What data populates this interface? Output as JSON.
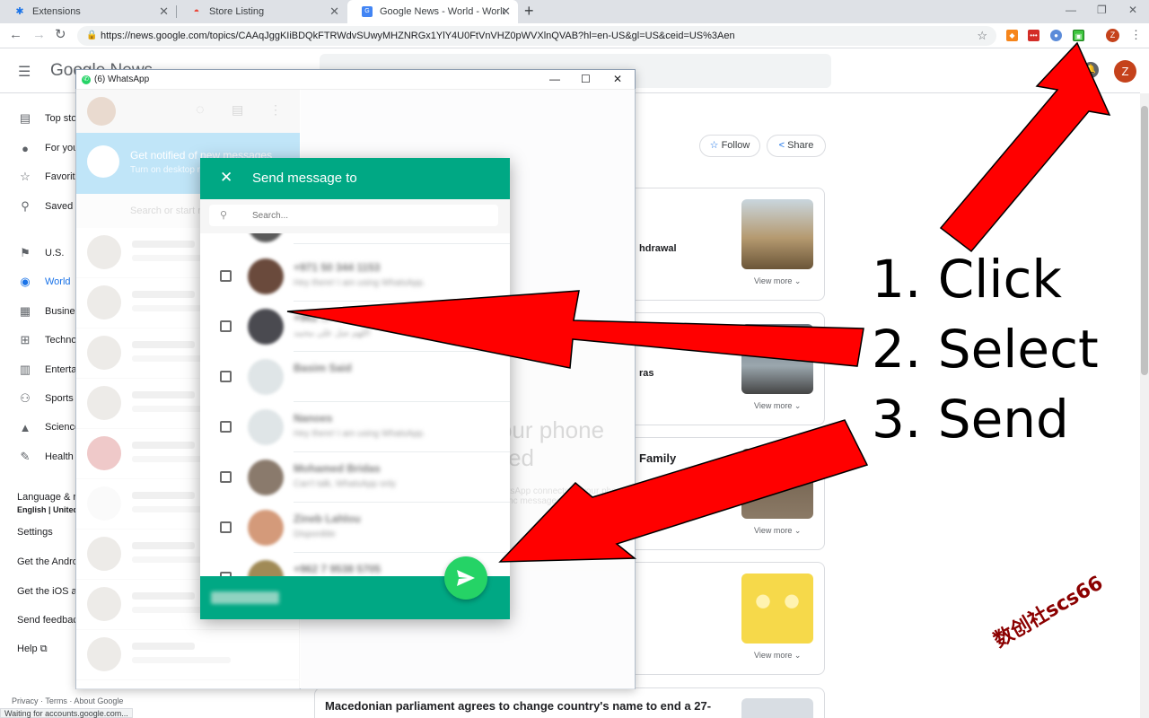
{
  "browser": {
    "tabs": [
      {
        "title": "Extensions",
        "icon": "puzzle-icon"
      },
      {
        "title": "Store Listing",
        "icon": "webstore-icon"
      },
      {
        "title": "Google News - World - World U",
        "icon": "google-news-icon"
      }
    ],
    "url": "https://news.google.com/topics/CAAqJggKIiBDQkFTRWdvSUwyMHZNRGx1YlY4U0FtVnVHZ0pWVXlnQVAB?hl=en-US&gl=US&ceid=US%3Aen",
    "profile_initial": "Z",
    "status": "Waiting for accounts.google.com..."
  },
  "news": {
    "logo_text": "Google News",
    "user_initial": "Z",
    "nav_items": [
      {
        "label": "Top stories",
        "icon": "newspaper-icon"
      },
      {
        "label": "For you",
        "icon": "person-icon"
      },
      {
        "label": "Favorites",
        "icon": "star-icon"
      },
      {
        "label": "Saved searches",
        "icon": "search-icon"
      },
      {
        "label": "U.S.",
        "icon": "flag-icon"
      },
      {
        "label": "World",
        "icon": "globe-icon"
      },
      {
        "label": "Business",
        "icon": "building-icon"
      },
      {
        "label": "Technology",
        "icon": "chip-icon"
      },
      {
        "label": "Entertainment",
        "icon": "film-icon"
      },
      {
        "label": "Sports",
        "icon": "bike-icon"
      },
      {
        "label": "Science",
        "icon": "flask-icon"
      },
      {
        "label": "Health",
        "icon": "health-icon"
      }
    ],
    "language_label": "Language & region",
    "language_value": "English | United States",
    "settings": "Settings",
    "android_app": "Get the Android app",
    "ios_app": "Get the iOS app",
    "feedback": "Send feedback",
    "help": "Help",
    "footer": "Privacy · Terms · About Google",
    "follow": "Follow",
    "share": "Share",
    "view_more": "View more",
    "snippets": [
      "hdrawal",
      "ras",
      "Family"
    ],
    "headline": "Macedonian parliament agrees to change country's name to end a 27-"
  },
  "whatsapp": {
    "window_title": "(6) WhatsApp",
    "notif_title": "Get notified of new messages",
    "notif_sub": "Turn on desktop notifications",
    "search_placeholder": "Search or start new chat",
    "phone_title": "Keep your phone connected",
    "phone_sub": "WhatsApp connects to your phone to sync messages."
  },
  "dialog": {
    "title": "Send message to",
    "search_placeholder": "Search...",
    "contacts": [
      {
        "name": "+971 50 344 1153",
        "status": "Hey there! I am using WhatsApp."
      },
      {
        "name": "+962 ...",
        "status": "اللهم صل على محمد"
      },
      {
        "name": "Basim Said",
        "status": ""
      },
      {
        "name": "Nanoes",
        "status": "Hey there! I am using WhatsApp."
      },
      {
        "name": "Mohamed Bridas",
        "status": "Can't talk, WhatsApp only"
      },
      {
        "name": "Zineb Lahlou",
        "status": "Disponible"
      },
      {
        "name": "+962 7 9538 5705",
        "status": ""
      }
    ]
  },
  "instructions": {
    "step1": "1. Click",
    "step2": "2. Select",
    "step3": "3. Send"
  },
  "watermark": "数创社scs66"
}
